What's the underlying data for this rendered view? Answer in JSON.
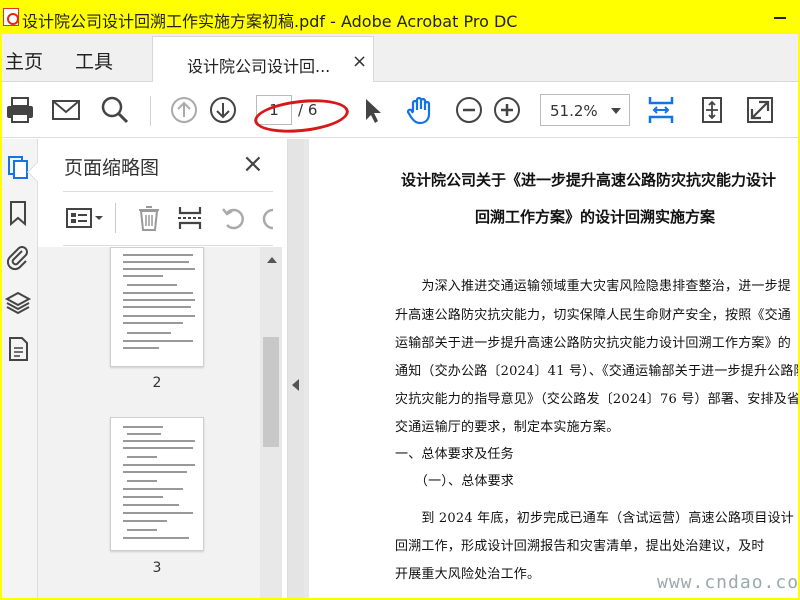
{
  "window": {
    "title": "设计院公司设计回溯工作实施方案初稿.pdf - Adobe Acrobat Pro DC"
  },
  "tabs": {
    "home": "主页",
    "tools": "工具",
    "document": "设计院公司设计回...",
    "close_glyph": "×"
  },
  "toolbar": {
    "current_page": "1",
    "total_pages": "/ 6",
    "zoom": "51.2%"
  },
  "panel": {
    "title": "页面缩略图",
    "close_glyph": "×",
    "thumbnails": [
      {
        "page": "2"
      },
      {
        "page": "3"
      }
    ]
  },
  "document": {
    "title_line1": "设计院公司关于《进一步提升高速公路防灾抗灾能力设计",
    "title_line2": "回溯工作方案》的设计回溯实施方案",
    "lines": [
      "　　为深入推进交通运输领域重大灾害风险隐患排查整治，进一步提",
      "升高速公路防灾抗灾能力，切实保障人民生命财产安全，按照《交通",
      "运输部关于进一步提升高速公路防灾抗灾能力设计回溯工作方案》的",
      "通知（交办公路〔2024〕41 号）、《交通运输部关于进一步提升公路防",
      "灾抗灾能力的指导意见》（交公路发〔2024〕76 号）部署、安排及省",
      "交通运输厅的要求，制定本实施方案。",
      "一、总体要求及任务",
      "　　（一）、总体要求",
      "　　到 2024 年底，初步完成已通车（含试运营）高速公路项目设计",
      "回溯工作，形成设计回溯报告和灾害清单，提出处治建议，及时",
      "开展重大风险处治工作。"
    ]
  },
  "watermark": "www.cndao.com",
  "colors": {
    "accent_blue": "#1473e6",
    "highlight_yellow": "#ffff00",
    "annotation_red": "#d81818"
  }
}
